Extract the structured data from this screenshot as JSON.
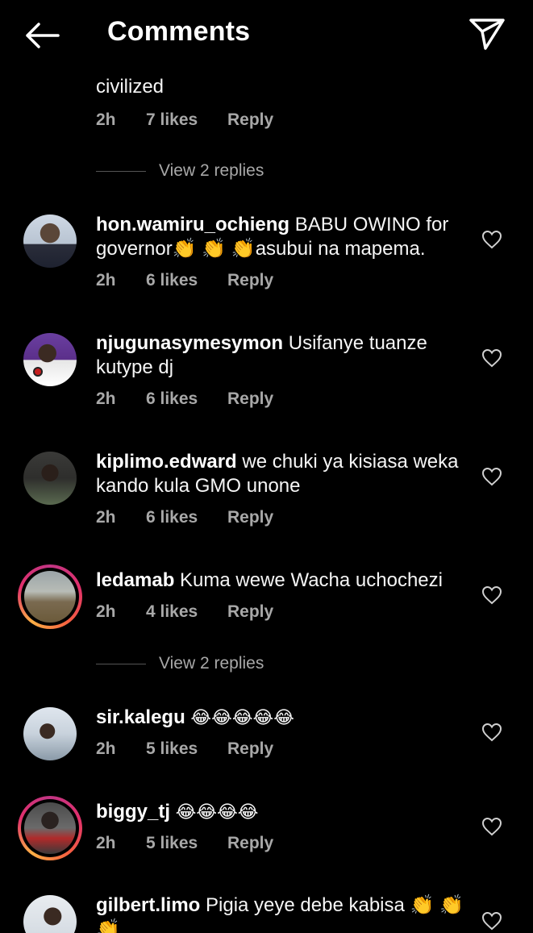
{
  "header": {
    "title": "Comments",
    "back_icon": "arrow-left-icon",
    "share_icon": "paper-plane-icon"
  },
  "comments": [
    {
      "username": "",
      "text": "civilized",
      "time": "2h",
      "likes": "7 likes",
      "reply": "Reply",
      "view_replies": "View 2 replies"
    },
    {
      "username": "hon.wamiru_ochieng",
      "text": "BABU OWINO for governor👏 👏 👏asubui na mapema.",
      "time": "2h",
      "likes": "6 likes",
      "reply": "Reply"
    },
    {
      "username": "njugunasymesymon",
      "text": "Usifanye tuanze kutype dj",
      "time": "2h",
      "likes": "6 likes",
      "reply": "Reply"
    },
    {
      "username": "kiplimo.edward",
      "text": "we chuki ya kisiasa weka kando kula GMO unone",
      "time": "2h",
      "likes": "6 likes",
      "reply": "Reply"
    },
    {
      "username": "ledamab",
      "text": "Kuma wewe Wacha uchochezi",
      "time": "2h",
      "likes": "4 likes",
      "reply": "Reply",
      "view_replies": "View 2 replies"
    },
    {
      "username": "sir.kalegu",
      "text": "😂😂😂😂😂",
      "time": "2h",
      "likes": "5 likes",
      "reply": "Reply"
    },
    {
      "username": "biggy_tj",
      "text": "😂😂😂😂",
      "time": "2h",
      "likes": "5 likes",
      "reply": "Reply"
    },
    {
      "username": "gilbert.limo",
      "text": "Pigia yeye debe kabisa 👏 👏 👏",
      "time": "",
      "likes": "",
      "reply": ""
    }
  ],
  "colors": {
    "background": "#000000",
    "text": "#ffffff",
    "meta": "#a8a8a8"
  }
}
